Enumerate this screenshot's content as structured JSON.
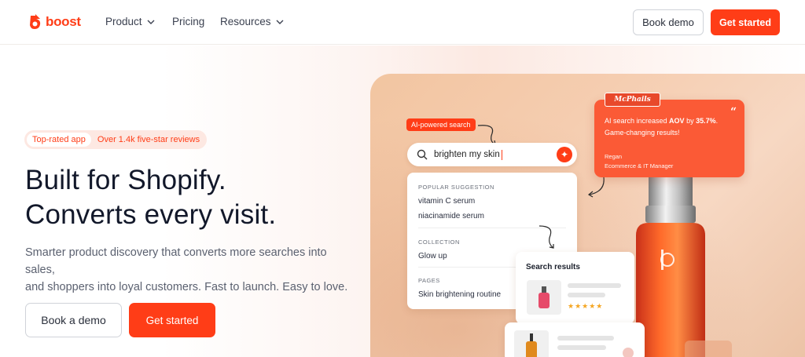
{
  "nav": {
    "logo_text": "boost",
    "items": [
      {
        "label": "Product",
        "has_dropdown": true
      },
      {
        "label": "Pricing",
        "has_dropdown": false
      },
      {
        "label": "Resources",
        "has_dropdown": true
      }
    ],
    "book_demo": "Book demo",
    "get_started": "Get started"
  },
  "hero": {
    "badge_a": "Top-rated app",
    "badge_b": "Over 1.4k five-star reviews",
    "title_line1": "Built for Shopify.",
    "title_line2": "Converts every visit.",
    "subtitle_line1": "Smarter product discovery that converts more searches into sales,",
    "subtitle_line2": "and shoppers into loyal customers. Fast to launch. Easy to love.",
    "book_demo": "Book a demo",
    "get_started": "Get started"
  },
  "showcase": {
    "ai_tag": "AI-powered search",
    "search_value": "brighten my skin",
    "popular_label": "POPULAR SUGGESTION",
    "popular_items": [
      "vitamin C serum",
      "niacinamide serum"
    ],
    "collection_label": "COLLECTION",
    "collection_items": [
      "Glow up"
    ],
    "pages_label": "PAGES",
    "pages_items": [
      "Skin brightening routine"
    ],
    "testimonial": {
      "brand": "McPhails",
      "text_pre": "AI search increased ",
      "text_b1": "AOV",
      "text_mid": " by ",
      "text_b2": "35.7%",
      "text_post": ". Game-changing results!",
      "name": "Regan",
      "role": "Ecommerce & IT Manager"
    },
    "results_title": "Search results",
    "rating_stars": "★★★★★"
  },
  "colors": {
    "brand": "#ff3d17",
    "text_dark": "#12182a",
    "text_muted": "#5b6170"
  }
}
